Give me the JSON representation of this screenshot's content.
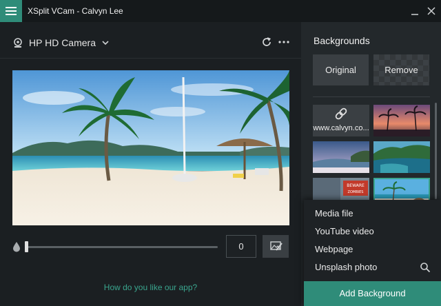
{
  "window": {
    "title": "XSplit VCam - Calvyn Lee"
  },
  "camera": {
    "name": "HP HD Camera",
    "blur_value": "0"
  },
  "footer": {
    "feedback_link": "How do you like our app?"
  },
  "backgrounds": {
    "title": "Backgrounds",
    "original_label": "Original",
    "remove_label": "Remove",
    "link_thumb_label": "www.calvyn.co...",
    "tiles": [
      "link",
      "sunset-palms",
      "stormy-beach",
      "green-cliffs",
      "zombies-sign",
      "tropical-beach"
    ]
  },
  "add_menu": {
    "items": [
      "Media file",
      "YouTube video",
      "Webpage",
      "Unsplash photo"
    ],
    "add_button": "Add Background"
  },
  "colors": {
    "accent": "#2f8c79",
    "link_text": "#3aa58e",
    "panel_dark": "#1b1f22",
    "panel_right": "#23282b"
  },
  "icons": [
    "menu-icon",
    "minimize-icon",
    "close-icon",
    "webcam-icon",
    "chevron-down-icon",
    "refresh-icon",
    "more-icon",
    "droplet-icon",
    "edit-image-icon",
    "link-icon",
    "search-icon"
  ]
}
